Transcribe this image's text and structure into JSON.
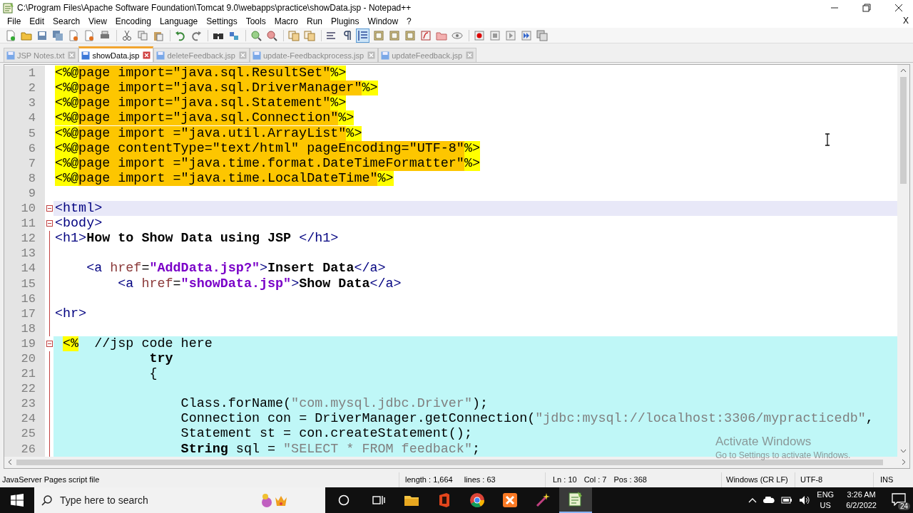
{
  "window": {
    "title": "C:\\Program Files\\Apache Software Foundation\\Tomcat 9.0\\webapps\\practice\\showData.jsp - Notepad++"
  },
  "menu": [
    "File",
    "Edit",
    "Search",
    "View",
    "Encoding",
    "Language",
    "Settings",
    "Tools",
    "Macro",
    "Run",
    "Plugins",
    "Window",
    "?"
  ],
  "doc_close": "X",
  "toolbar": [
    {
      "kind": "new",
      "pressed": false
    },
    {
      "kind": "open",
      "pressed": false
    },
    {
      "kind": "save",
      "pressed": false
    },
    {
      "kind": "save-all",
      "pressed": false
    },
    {
      "kind": "close",
      "pressed": false
    },
    {
      "kind": "close-all",
      "pressed": false
    },
    {
      "kind": "print",
      "pressed": false
    },
    {
      "kind": "separator"
    },
    {
      "kind": "cut",
      "pressed": false
    },
    {
      "kind": "copy",
      "pressed": false
    },
    {
      "kind": "paste",
      "pressed": false
    },
    {
      "kind": "separator"
    },
    {
      "kind": "undo",
      "pressed": false
    },
    {
      "kind": "redo",
      "pressed": false
    },
    {
      "kind": "separator"
    },
    {
      "kind": "find",
      "pressed": false
    },
    {
      "kind": "replace",
      "pressed": false
    },
    {
      "kind": "separator"
    },
    {
      "kind": "zoom-in",
      "pressed": false
    },
    {
      "kind": "zoom-out",
      "pressed": false
    },
    {
      "kind": "separator"
    },
    {
      "kind": "sync",
      "pressed": false
    },
    {
      "kind": "sync",
      "pressed": false
    },
    {
      "kind": "separator"
    },
    {
      "kind": "wrap",
      "pressed": false
    },
    {
      "kind": "pilcrow",
      "pressed": false
    },
    {
      "kind": "indent",
      "pressed": true
    },
    {
      "kind": "panel",
      "pressed": false
    },
    {
      "kind": "panel",
      "pressed": false
    },
    {
      "kind": "panel",
      "pressed": false
    },
    {
      "kind": "function",
      "pressed": false
    },
    {
      "kind": "folder",
      "pressed": false
    },
    {
      "kind": "eye",
      "pressed": false
    },
    {
      "kind": "separator"
    },
    {
      "kind": "record",
      "pressed": false
    },
    {
      "kind": "stop",
      "pressed": false
    },
    {
      "kind": "play",
      "pressed": false
    },
    {
      "kind": "play-many",
      "pressed": false
    },
    {
      "kind": "save-macro",
      "pressed": false
    }
  ],
  "tabs": [
    {
      "label": "JSP Notes.txt",
      "selected": false
    },
    {
      "label": "showData.jsp",
      "selected": true
    },
    {
      "label": "deleteFeedback.jsp",
      "selected": false
    },
    {
      "label": "update-Feedbackprocess.jsp",
      "selected": false
    },
    {
      "label": "updateFeedback.jsp",
      "selected": false
    }
  ],
  "lines": [
    {
      "number": "1",
      "fold_marker": false,
      "fold_guide": false,
      "current": false,
      "script": false,
      "segments": [
        {
          "kind": "delim",
          "text": "<%@"
        },
        {
          "kind": "directive",
          "text": "page import=\"java.sql.ResultSet\""
        },
        {
          "kind": "delim",
          "text": "%>"
        }
      ]
    },
    {
      "number": "2",
      "fold_marker": false,
      "fold_guide": false,
      "current": false,
      "script": false,
      "segments": [
        {
          "kind": "delim",
          "text": "<%@"
        },
        {
          "kind": "directive",
          "text": "page import=\"java.sql.DriverManager\""
        },
        {
          "kind": "delim",
          "text": "%>"
        }
      ]
    },
    {
      "number": "3",
      "fold_marker": false,
      "fold_guide": false,
      "current": false,
      "script": false,
      "segments": [
        {
          "kind": "delim",
          "text": "<%@"
        },
        {
          "kind": "directive",
          "text": "page import=\"java.sql.Statement\""
        },
        {
          "kind": "delim",
          "text": "%>"
        }
      ]
    },
    {
      "number": "4",
      "fold_marker": false,
      "fold_guide": false,
      "current": false,
      "script": false,
      "segments": [
        {
          "kind": "delim",
          "text": "<%@"
        },
        {
          "kind": "directive",
          "text": "page import=\"java.sql.Connection\""
        },
        {
          "kind": "delim",
          "text": "%>"
        }
      ]
    },
    {
      "number": "5",
      "fold_marker": false,
      "fold_guide": false,
      "current": false,
      "script": false,
      "segments": [
        {
          "kind": "delim",
          "text": "<%@"
        },
        {
          "kind": "directive",
          "text": "page import =\"java.util.ArrayList\""
        },
        {
          "kind": "delim",
          "text": "%>"
        }
      ]
    },
    {
      "number": "6",
      "fold_marker": false,
      "fold_guide": false,
      "current": false,
      "script": false,
      "segments": [
        {
          "kind": "delim",
          "text": "<%@"
        },
        {
          "kind": "directive",
          "text": "page contentType=\"text/html\" pageEncoding=\"UTF-8\""
        },
        {
          "kind": "delim",
          "text": "%>"
        }
      ]
    },
    {
      "number": "7",
      "fold_marker": false,
      "fold_guide": false,
      "current": false,
      "script": false,
      "segments": [
        {
          "kind": "delim",
          "text": "<%@"
        },
        {
          "kind": "directive",
          "text": "page import =\"java.time.format.DateTimeFormatter\""
        },
        {
          "kind": "delim",
          "text": "%>"
        }
      ]
    },
    {
      "number": "8",
      "fold_marker": false,
      "fold_guide": false,
      "current": false,
      "script": false,
      "segments": [
        {
          "kind": "delim",
          "text": "<%@"
        },
        {
          "kind": "directive",
          "text": "page import =\"java.time.LocalDateTime\""
        },
        {
          "kind": "delim",
          "text": "%>"
        }
      ]
    },
    {
      "number": "9",
      "fold_marker": false,
      "fold_guide": false,
      "current": false,
      "script": false
    },
    {
      "number": "10",
      "fold_marker": true,
      "fold_guide": false,
      "current": true,
      "script": false,
      "segments": [
        {
          "kind": "tag",
          "text": "<html>"
        }
      ]
    },
    {
      "number": "11",
      "fold_marker": true,
      "fold_guide": false,
      "current": false,
      "script": false,
      "segments": [
        {
          "kind": "tag",
          "text": "<body>"
        }
      ]
    },
    {
      "number": "12",
      "fold_marker": false,
      "fold_guide": true,
      "current": false,
      "script": false,
      "segments": [
        {
          "kind": "tag",
          "text": "<h1>"
        },
        {
          "kind": "content",
          "text": "How to Show Data using JSP "
        },
        {
          "kind": "tag",
          "text": "</h1>"
        }
      ]
    },
    {
      "number": "13",
      "fold_marker": false,
      "fold_guide": true,
      "current": false,
      "script": false
    },
    {
      "number": "14",
      "fold_marker": false,
      "fold_guide": true,
      "current": false,
      "script": false,
      "segments": [
        {
          "kind": "tag",
          "text": "    <a "
        },
        {
          "kind": "attr",
          "text": "href"
        },
        {
          "kind": "plain",
          "text": "="
        },
        {
          "kind": "value",
          "text": "\"AddData.jsp?\""
        },
        {
          "kind": "tag",
          "text": ">"
        },
        {
          "kind": "content",
          "text": "Insert Data"
        },
        {
          "kind": "tag",
          "text": "</a>"
        }
      ]
    },
    {
      "number": "15",
      "fold_marker": false,
      "fold_guide": true,
      "current": false,
      "script": false,
      "segments": [
        {
          "kind": "tag",
          "text": "        <a "
        },
        {
          "kind": "attr",
          "text": "href"
        },
        {
          "kind": "plain",
          "text": "="
        },
        {
          "kind": "value",
          "text": "\"showData.jsp\""
        },
        {
          "kind": "tag",
          "text": ">"
        },
        {
          "kind": "content",
          "text": "Show Data"
        },
        {
          "kind": "tag",
          "text": "</a>"
        }
      ]
    },
    {
      "number": "16",
      "fold_marker": false,
      "fold_guide": true,
      "current": false,
      "script": false
    },
    {
      "number": "17",
      "fold_marker": false,
      "fold_guide": true,
      "current": false,
      "script": false,
      "segments": [
        {
          "kind": "tag",
          "text": "<hr>"
        }
      ]
    },
    {
      "number": "18",
      "fold_marker": false,
      "fold_guide": true,
      "current": false,
      "script": false
    },
    {
      "number": "19",
      "fold_marker": true,
      "fold_guide": false,
      "current": false,
      "script": true,
      "segments": [
        {
          "kind": "delim",
          "text": " <%"
        },
        {
          "kind": "plain",
          "text": "  //jsp code here"
        }
      ]
    },
    {
      "number": "20",
      "fold_marker": false,
      "fold_guide": true,
      "current": false,
      "script": true,
      "segments": [
        {
          "kind": "keyword",
          "text": "            try"
        }
      ]
    },
    {
      "number": "21",
      "fold_marker": false,
      "fold_guide": true,
      "current": false,
      "script": true,
      "segments": [
        {
          "kind": "plain",
          "text": "            {"
        }
      ]
    },
    {
      "number": "22",
      "fold_marker": false,
      "fold_guide": true,
      "current": false,
      "script": true
    },
    {
      "number": "23",
      "fold_marker": false,
      "fold_guide": true,
      "current": false,
      "script": true,
      "segments": [
        {
          "kind": "plain",
          "text": "                Class.forName("
        },
        {
          "kind": "string",
          "text": "\"com.mysql.jdbc.Driver\""
        },
        {
          "kind": "plain",
          "text": ");"
        }
      ]
    },
    {
      "number": "24",
      "fold_marker": false,
      "fold_guide": true,
      "current": false,
      "script": true,
      "segments": [
        {
          "kind": "plain",
          "text": "                Connection con = DriverManager.getConnection("
        },
        {
          "kind": "string",
          "text": "\"jdbc:mysql://localhost:3306/mypracticedb\""
        },
        {
          "kind": "plain",
          "text": ","
        }
      ]
    },
    {
      "number": "25",
      "fold_marker": false,
      "fold_guide": true,
      "current": false,
      "script": true,
      "segments": [
        {
          "kind": "plain",
          "text": "                Statement st = con.createStatement();"
        }
      ]
    },
    {
      "number": "26",
      "fold_marker": false,
      "fold_guide": true,
      "current": false,
      "script": true,
      "segments": [
        {
          "kind": "keyword",
          "text": "                String"
        },
        {
          "kind": "plain",
          "text": " sql = "
        },
        {
          "kind": "string",
          "text": "\"SELECT * FROM feedback\""
        },
        {
          "kind": "plain",
          "text": ";"
        }
      ]
    }
  ],
  "status_bar": {
    "file_type": "JavaServer Pages script file",
    "length": "length : 1,664",
    "lines": "lines : 63",
    "ln": "Ln : 10",
    "col": "Col : 7",
    "pos": "Pos : 368",
    "eol": "Windows (CR LF)",
    "encoding": "UTF-8",
    "mode": "INS"
  },
  "activation": {
    "title": "Activate Windows",
    "hint": "Go to Settings to activate Windows."
  },
  "taskbar": {
    "search_placeholder": "Type here to search",
    "apps": [
      {
        "kind": "explorer",
        "selected": false
      },
      {
        "kind": "office",
        "selected": false
      },
      {
        "kind": "chrome",
        "selected": false
      },
      {
        "kind": "xampp",
        "selected": false
      },
      {
        "kind": "wand",
        "selected": false
      },
      {
        "kind": "notepad",
        "selected": true
      }
    ],
    "language": "ENG",
    "region": "US",
    "time": "3:26 AM",
    "date": "6/2/2022",
    "notifications": "24"
  }
}
